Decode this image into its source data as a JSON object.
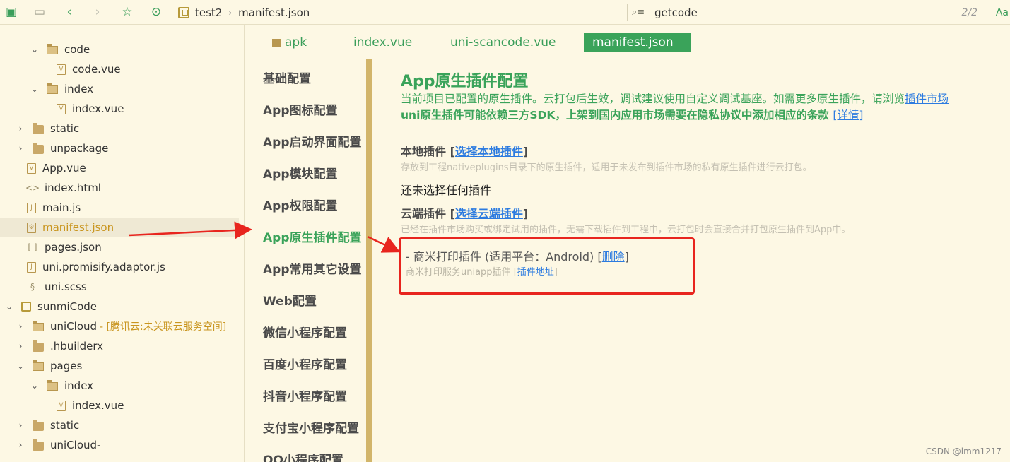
{
  "toolbar": {
    "icons": [
      "save-all-icon",
      "save-icon",
      "back-icon",
      "forward-icon",
      "star-icon",
      "run-icon"
    ],
    "breadcrumb": [
      "test2",
      "manifest.json"
    ],
    "search": {
      "value": "getcode",
      "count": "2/2",
      "case_toggle": "Aa"
    }
  },
  "tree": [
    {
      "label": "code",
      "type": "folder-open",
      "indent": 1,
      "chev": "⌄"
    },
    {
      "label": "code.vue",
      "type": "vue",
      "indent": 3
    },
    {
      "label": "index",
      "type": "folder-open",
      "indent": 1,
      "chev": "⌄"
    },
    {
      "label": "index.vue",
      "type": "vue",
      "indent": 3
    },
    {
      "label": "static",
      "type": "folder",
      "indent": 0,
      "chev": "›"
    },
    {
      "label": "unpackage",
      "type": "folder",
      "indent": 0,
      "chev": "›"
    },
    {
      "label": "App.vue",
      "type": "vue",
      "indent": 1
    },
    {
      "label": "index.html",
      "type": "html",
      "indent": 1
    },
    {
      "label": "main.js",
      "type": "js",
      "indent": 1
    },
    {
      "label": "manifest.json",
      "type": "json",
      "indent": 1,
      "selected": true
    },
    {
      "label": "pages.json",
      "type": "brackets",
      "indent": 1
    },
    {
      "label": "uni.promisify.adaptor.js",
      "type": "js",
      "indent": 1
    },
    {
      "label": "uni.scss",
      "type": "scss",
      "indent": 1
    },
    {
      "label": "sunmiCode",
      "type": "project",
      "indent": -1,
      "chev": "⌄"
    },
    {
      "label": "uniCloud",
      "type": "folder-open",
      "indent": 0,
      "chev": "›",
      "note": "- [腾讯云:未关联云服务空间]"
    },
    {
      "label": ".hbuilderx",
      "type": "folder",
      "indent": 0,
      "chev": "›"
    },
    {
      "label": "pages",
      "type": "folder-open",
      "indent": 0,
      "chev": "⌄"
    },
    {
      "label": "index",
      "type": "folder-open",
      "indent": 1,
      "chev": "⌄"
    },
    {
      "label": "index.vue",
      "type": "vue",
      "indent": 3
    },
    {
      "label": "static",
      "type": "folder",
      "indent": 0,
      "chev": "›"
    },
    {
      "label": "uniCloud-",
      "type": "folder",
      "indent": 0,
      "chev": "›"
    }
  ],
  "tabs": [
    {
      "label": "apk",
      "folder": true
    },
    {
      "label": "index.vue"
    },
    {
      "label": "uni-scancode.vue"
    },
    {
      "label": "manifest.json",
      "active": true
    }
  ],
  "menu": [
    "基础配置",
    "App图标配置",
    "App启动界面配置",
    "App模块配置",
    "App权限配置",
    "App原生插件配置",
    "App常用其它设置",
    "Web配置",
    "微信小程序配置",
    "百度小程序配置",
    "抖音小程序配置",
    "支付宝小程序配置",
    "QQ小程序配置"
  ],
  "menu_active": "App原生插件配置",
  "content": {
    "title": "App原生插件配置",
    "desc": "当前项目已配置的原生插件。云打包后生效，调试建议使用自定义调试基座。如需更多原生插件，请浏览",
    "desc_link": "插件市场",
    "desc2": "uni原生插件可能依赖三方SDK，上架到国内应用市场需要在隐私协议中添加相应的条款 ",
    "desc2_link": "[详情]",
    "local": {
      "title": "本地插件 [",
      "link": "选择本地插件",
      "close": "]",
      "hint": "存放到工程nativeplugins目录下的原生插件，适用于未发布到插件市场的私有原生插件进行云打包。",
      "empty": "还未选择任何插件"
    },
    "cloud": {
      "title": "云端插件 [",
      "link": "选择云端插件",
      "close": "]",
      "hint": "已经在插件市场购买或绑定试用的插件，无需下载插件到工程中，云打包时会直接合并打包原生插件到App中。"
    },
    "plugin": {
      "name": "- 商米打印插件 (适用平台：Android) [",
      "delete": "删除",
      "name_close": "]",
      "sub": "商米打印服务uniapp插件 [",
      "sub_link": "插件地址",
      "sub_close": "]"
    }
  },
  "watermark": "CSDN @lmm1217",
  "colors": {
    "accent": "#3aa35a",
    "link": "#2c7be0",
    "annotation": "#e8251e",
    "background": "#fdf8e4"
  }
}
